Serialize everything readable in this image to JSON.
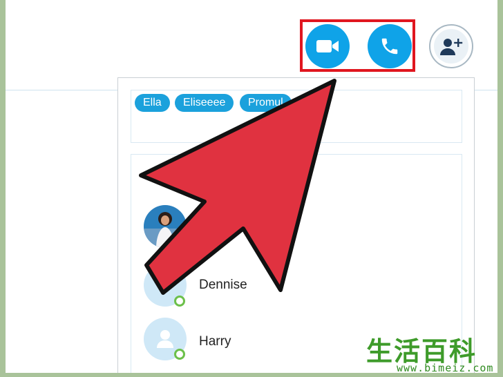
{
  "toolbar": {
    "video_call_icon": "video-camera",
    "voice_call_icon": "phone",
    "add_people_icon": "add-person"
  },
  "chips": [
    "Ella",
    "Eliseeee",
    "Promul"
  ],
  "contacts": [
    {
      "name": ""
    },
    {
      "name": "Dennise"
    },
    {
      "name": "Harry"
    }
  ],
  "watermark": {
    "logo": "生活百科",
    "url": "www.bimeiz.com"
  },
  "colors": {
    "accent": "#0fa3e8",
    "highlight_box": "#e0161f",
    "arrow_fill": "#e03240",
    "status_online": "#6cc04a",
    "chip_bg": "#1ba1dc"
  }
}
